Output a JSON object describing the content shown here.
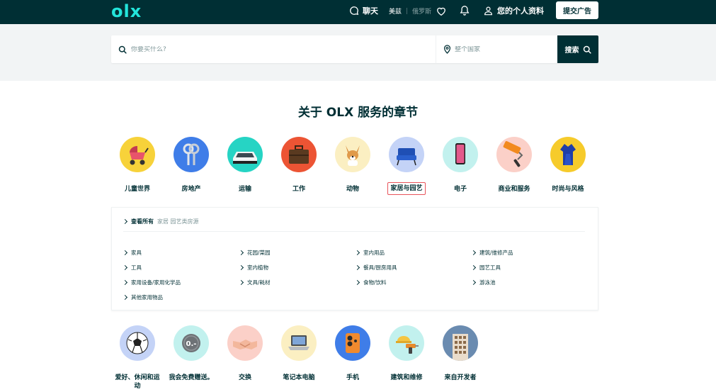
{
  "topbar": {
    "logo": "olx",
    "chat": "聊天",
    "lang_active": "美兹",
    "lang_sep": "|",
    "lang_inactive": "俄罗斯",
    "profile": "您的个人资料",
    "post_ad": "提交广告"
  },
  "search": {
    "query_placeholder": "你要买什么?",
    "location_placeholder": "整个国家",
    "button": "搜索"
  },
  "section_title": "关于 OLX 服务的章节",
  "categories_row1": [
    {
      "label": "儿童世界",
      "icon": "stroller-icon",
      "bg": "#f7d23a"
    },
    {
      "label": "房地产",
      "icon": "keys-icon",
      "bg": "#3f7de8"
    },
    {
      "label": "运输",
      "icon": "car-icon",
      "bg": "#26d4c4"
    },
    {
      "label": "工作",
      "icon": "briefcase-icon",
      "bg": "#ec5434"
    },
    {
      "label": "动物",
      "icon": "dog-icon",
      "bg": "#fbefc2"
    },
    {
      "label": "家居与园艺",
      "icon": "armchair-icon",
      "bg": "#c4d3f7"
    },
    {
      "label": "电子",
      "icon": "phone-icon",
      "bg": "#c2f1ee"
    },
    {
      "label": "商业和服务",
      "icon": "paint-roller-icon",
      "bg": "#fbd0c8"
    },
    {
      "label": "时尚与风格",
      "icon": "dress-icon",
      "bg": "#f6cb2b"
    }
  ],
  "panel": {
    "view_all": "查看所有",
    "view_all_sub": "家居 园艺类房源",
    "columns": [
      [
        "家具",
        "工具",
        "家用设备/家用化学品",
        "其他家用物品"
      ],
      [
        "花园/菜园",
        "室内植物",
        "文具/耗材"
      ],
      [
        "室内用品",
        "餐具/厨房用具",
        "食物/饮料"
      ],
      [
        "建筑/维修产品",
        "园艺工具",
        "游泳池"
      ]
    ]
  },
  "categories_row2": [
    {
      "label": "爱好、休闲和运动",
      "icon": "soccer-ball-icon",
      "bg": "#c4d3f7"
    },
    {
      "label": "我会免费赠送。",
      "icon": "free-coin-icon",
      "bg": "#c2f1ee"
    },
    {
      "label": "交换",
      "icon": "handshake-icon",
      "bg": "#fbd0c8"
    },
    {
      "label": "笔记本电脑",
      "icon": "laptop-icon",
      "bg": "#fbefc2"
    },
    {
      "label": "手机",
      "icon": "mobile-phone-icon",
      "bg": "#3f7de8"
    },
    {
      "label": "建筑和维修",
      "icon": "drill-icon",
      "bg": "#c2f1ee"
    },
    {
      "label": "来自开发者",
      "icon": "building-icon",
      "bg": "#6a8bb0"
    }
  ],
  "colors": {
    "brand_dark": "#002f34",
    "brand_logo": "#23e5db",
    "selected_border": "#e8545b"
  }
}
